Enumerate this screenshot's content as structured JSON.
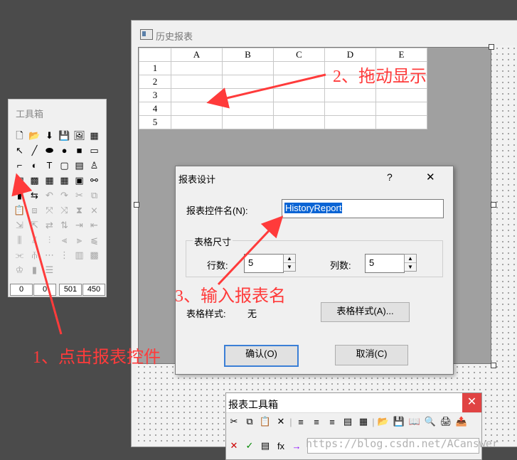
{
  "form_window": {
    "title": "历史报表"
  },
  "sheet": {
    "columns": [
      "A",
      "B",
      "C",
      "D",
      "E"
    ],
    "rows": [
      "1",
      "2",
      "3",
      "4",
      "5"
    ]
  },
  "toolbox": {
    "title": "工具箱",
    "tools": [
      "🗋",
      "📂",
      "⬇",
      "💾",
      "🖼",
      "▦",
      "↖",
      "╱",
      "⬬",
      "●",
      "■",
      "▭",
      "⌐",
      "◐",
      "T",
      "▢",
      "▤",
      "♙",
      "▤",
      "▩",
      "▦",
      "▦",
      "▣",
      "⚯",
      "▮",
      "⇆",
      "↶",
      "↷",
      "✂",
      "⧉",
      "📋",
      "⧈",
      "⤧",
      "⤨",
      "⧗",
      "⨯",
      "⇲",
      "⇱",
      "⇄",
      "⇅",
      "⇥",
      "⇤",
      "⫼",
      "⫽",
      "⫶",
      "⫷",
      "⫸",
      "⫹",
      "⫘",
      "⫚",
      "⋯",
      "⋮",
      "▥",
      "▩",
      "♔",
      "▮",
      "☰"
    ],
    "fields": [
      "0",
      "0",
      "501",
      "450"
    ]
  },
  "dialog": {
    "title": "报表设计",
    "help_label": "?",
    "close_label": "✕",
    "name_label": "报表控件名(N):",
    "name_value": "HistoryReport",
    "group_label": "表格尺寸",
    "rows_label": "行数:",
    "rows_value": "5",
    "cols_label": "列数:",
    "cols_value": "5",
    "style_label": "表格样式:",
    "style_value": "无",
    "style_button": "表格样式(A)...",
    "ok_button": "确认(O)",
    "cancel_button": "取消(C)"
  },
  "report_toolbar": {
    "title": "报表工具箱",
    "close_label": "✕",
    "row1": [
      "✂",
      "⧉",
      "📋",
      "✕",
      "|",
      "≡",
      "≡",
      "≡",
      "▤",
      "▦",
      "|",
      "📂",
      "💾",
      "📖",
      "🔍",
      "🖨",
      "📤"
    ],
    "row2": [
      "✕",
      "✓",
      "▤",
      "fx",
      "→"
    ]
  },
  "annotations": {
    "step1": "1、点击报表控件",
    "step2": "2、拖动显示",
    "step3": "3、输入报表名",
    "color": "#ff3b3b"
  },
  "watermark": "https://blog.csdn.net/ACanswer"
}
